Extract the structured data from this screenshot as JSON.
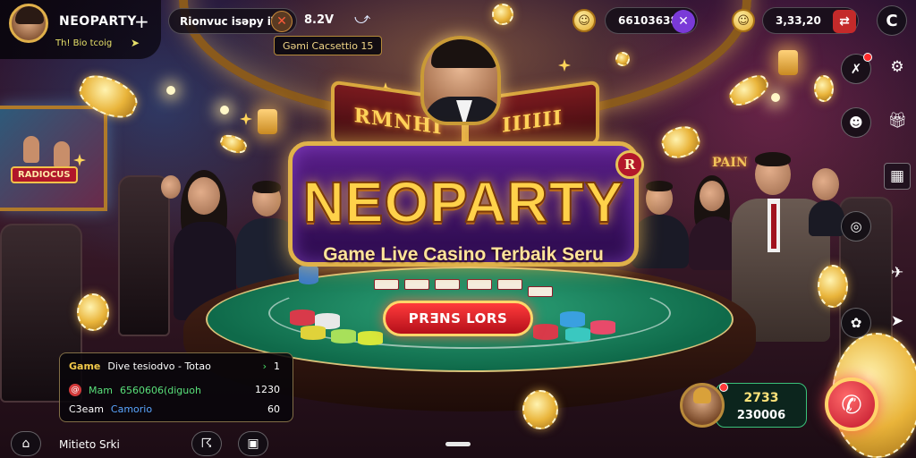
{
  "header": {
    "app_name": "NEOPARTY",
    "plus_label": "+",
    "sub_tag": "Th! Bio tcoig",
    "sub_tag_arrow": "➤",
    "search_text": "Rionvuc isəpy iʔ",
    "close_label": "✕",
    "status_text": "8.2V",
    "game_tag": "Gəmi Cacsettio 15",
    "balance_1": "66103638",
    "balance_1_action": "✕",
    "balance_2": "3,33,20",
    "balance_2_action": "⇄",
    "menu_label": "C"
  },
  "banner": {
    "title": "NEOPARTY",
    "subtitle": "Game Live Casino Terbaik Seru",
    "wing_left": "RMNHI",
    "wing_right": "IIIIII",
    "badge": "R",
    "action_label": "PRƎNS LORS",
    "monitor_label": "RADIOCUS",
    "wall_sign": "PAIN"
  },
  "info_panel": {
    "row1_game": "Game",
    "row1_text": "Dive tesiodvo - Totao",
    "row1_arrow": "›",
    "row1_value": "1",
    "row2_icon": "@",
    "row2_label": "Mam",
    "row2_value": "6560606(diguoh",
    "row2_number": "1230",
    "row3_label": "C3eam",
    "row3_value": "Camorio",
    "row3_number": "60"
  },
  "bottom": {
    "label": "Mitieto Srki"
  },
  "host": {
    "stat_1": "2733",
    "stat_2": "230006"
  },
  "icons": {
    "profile_plus": "plus-icon",
    "settings": "gear-icon",
    "call": "phone-icon"
  },
  "colors": {
    "accent_gold": "#e0b24a",
    "banner_purple": "#5a1f8a",
    "felt_green": "#0f6a4a",
    "action_red": "#c0142a"
  }
}
